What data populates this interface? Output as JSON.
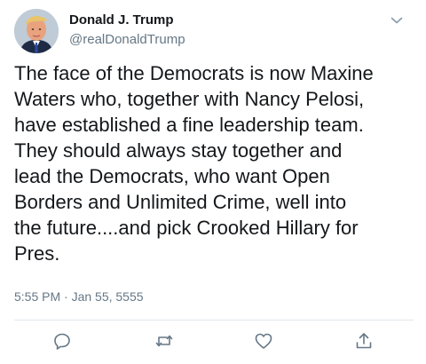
{
  "tweet": {
    "author": {
      "display_name": "Donald J. Trump",
      "handle": "@realDonaldTrump",
      "avatar_icon": "profile-photo"
    },
    "text": "The face of the Democrats is now Maxine\nWaters who, together with Nancy Pelosi,\nhave established a fine leadership team.\nThey should always stay together and\nlead the Democrats, who want Open\nBorders and Unlimited Crime, well into\nthe future....and pick Crooked Hillary for\nPres.",
    "timestamp": "5:55 PM · Jan 55, 5555",
    "menu_icon": "chevron-down-icon",
    "actions": [
      {
        "name": "reply",
        "icon": "reply-icon"
      },
      {
        "name": "retweet",
        "icon": "retweet-icon"
      },
      {
        "name": "like",
        "icon": "heart-icon"
      },
      {
        "name": "share",
        "icon": "share-icon"
      }
    ]
  },
  "colors": {
    "text_primary": "#14171a",
    "text_secondary": "#657786",
    "divider": "#e1e8ed",
    "icon": "#657786"
  }
}
